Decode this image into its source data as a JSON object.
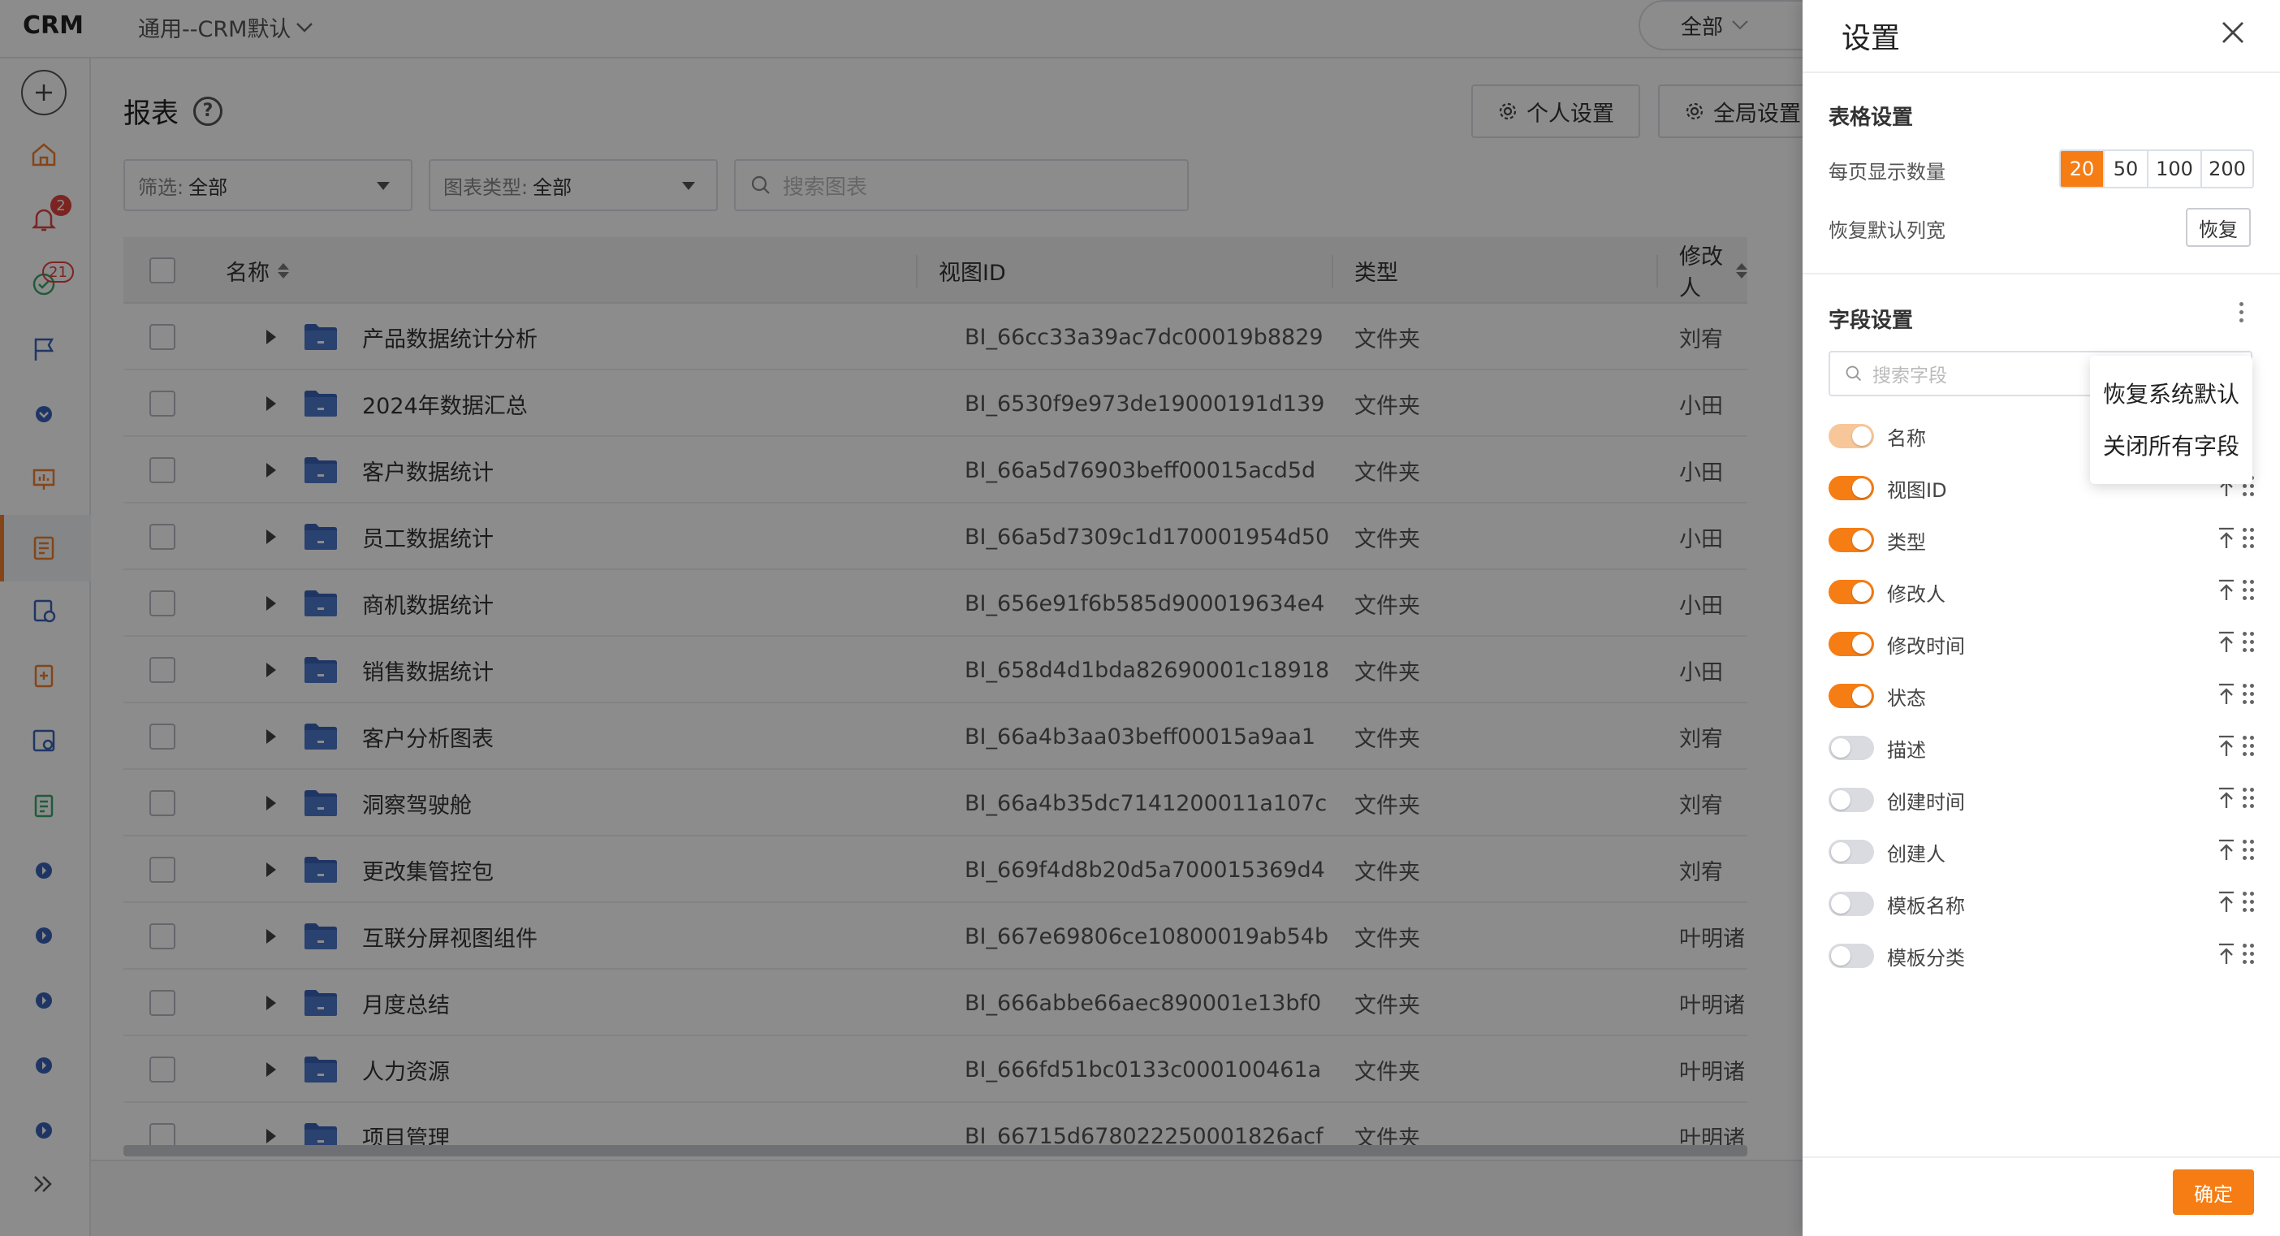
{
  "app": {
    "logo": "CRM",
    "space": "通用--CRM默认",
    "scope": "全部"
  },
  "sidebar": {
    "notif_badge": "2",
    "task_badge": "21"
  },
  "page": {
    "title": "报表"
  },
  "toolbar": {
    "personal_settings": "个人设置",
    "global_settings": "全局设置"
  },
  "filters": {
    "filter_label": "筛选:",
    "filter_value": "全部",
    "chart_type_label": "图表类型:",
    "chart_type_value": "全部",
    "search_placeholder": "搜索图表"
  },
  "table": {
    "columns": [
      "名称",
      "视图ID",
      "类型",
      "修改人"
    ],
    "rows": [
      {
        "name": "产品数据统计分析",
        "id": "BI_66cc33a39ac7dc00019b8829",
        "type": "文件夹",
        "modifier": "刘宥"
      },
      {
        "name": "2024年数据汇总",
        "id": "BI_6530f9e973de19000191d139",
        "type": "文件夹",
        "modifier": "小田"
      },
      {
        "name": "客户数据统计",
        "id": "BI_66a5d76903beff00015acd5d",
        "type": "文件夹",
        "modifier": "小田"
      },
      {
        "name": "员工数据统计",
        "id": "BI_66a5d7309c1d170001954d50",
        "type": "文件夹",
        "modifier": "小田"
      },
      {
        "name": "商机数据统计",
        "id": "BI_656e91f6b585d900019634e4",
        "type": "文件夹",
        "modifier": "小田"
      },
      {
        "name": "销售数据统计",
        "id": "BI_658d4d1bda82690001c18918",
        "type": "文件夹",
        "modifier": "小田"
      },
      {
        "name": "客户分析图表",
        "id": "BI_66a4b3aa03beff00015a9aa1",
        "type": "文件夹",
        "modifier": "刘宥"
      },
      {
        "name": "洞察驾驶舱",
        "id": "BI_66a4b35dc7141200011a107c",
        "type": "文件夹",
        "modifier": "刘宥"
      },
      {
        "name": "更改集管控包",
        "id": "BI_669f4d8b20d5a700015369d4",
        "type": "文件夹",
        "modifier": "刘宥"
      },
      {
        "name": "互联分屏视图组件",
        "id": "BI_667e69806ce10800019ab54b",
        "type": "文件夹",
        "modifier": "叶明诸"
      },
      {
        "name": "月度总结",
        "id": "BI_666abbe66aec890001e13bf0",
        "type": "文件夹",
        "modifier": "叶明诸"
      },
      {
        "name": "人力资源",
        "id": "BI_666fd51bc0133c000100461a",
        "type": "文件夹",
        "modifier": "叶明诸"
      },
      {
        "name": "项目管理",
        "id": "BI_66715d678022250001826acf",
        "type": "文件夹",
        "modifier": "叶明诸"
      }
    ]
  },
  "drawer": {
    "title": "设置",
    "table_settings": {
      "title": "表格设置",
      "page_size_label": "每页显示数量",
      "page_sizes": [
        "20",
        "50",
        "100",
        "200"
      ],
      "page_size_selected": "20",
      "restore_width_label": "恢复默认列宽",
      "restore_button": "恢复"
    },
    "field_settings": {
      "title": "字段设置",
      "search_placeholder": "搜索字段",
      "menu": [
        "恢复系统默认",
        "关闭所有字段"
      ],
      "fields": [
        {
          "name": "名称",
          "on": true,
          "locked": true
        },
        {
          "name": "视图ID",
          "on": true
        },
        {
          "name": "类型",
          "on": true
        },
        {
          "name": "修改人",
          "on": true
        },
        {
          "name": "修改时间",
          "on": true
        },
        {
          "name": "状态",
          "on": true
        },
        {
          "name": "描述",
          "on": false
        },
        {
          "name": "创建时间",
          "on": false
        },
        {
          "name": "创建人",
          "on": false
        },
        {
          "name": "模板名称",
          "on": false
        },
        {
          "name": "模板分类",
          "on": false
        }
      ]
    },
    "confirm_button": "确定"
  },
  "colors": {
    "accent": "#f57d14",
    "folder": "#3a63b8",
    "badge": "#e0433d"
  }
}
